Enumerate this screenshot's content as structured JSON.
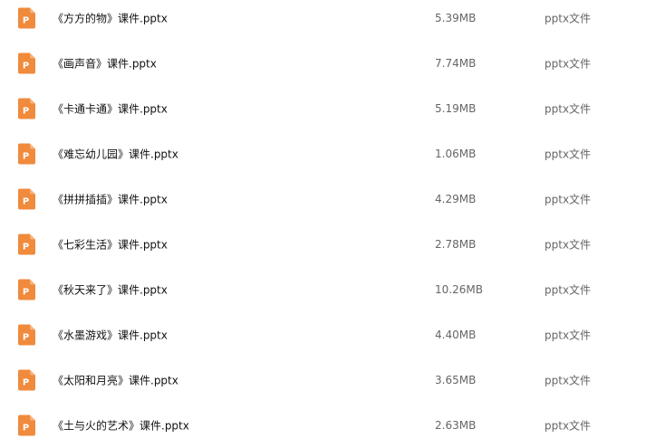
{
  "colors": {
    "icon_orange": "#f08a3c",
    "icon_orange_light": "#f7b27a",
    "icon_letter": "#ffffff",
    "text_primary": "#111111",
    "text_secondary": "#666666"
  },
  "files": [
    {
      "icon": "pptx-file-icon",
      "name": "《方方的物》课件.pptx",
      "size": "5.39MB",
      "type": "pptx文件"
    },
    {
      "icon": "pptx-file-icon",
      "name": "《画声音》课件.pptx",
      "size": "7.74MB",
      "type": "pptx文件"
    },
    {
      "icon": "pptx-file-icon",
      "name": "《卡通卡通》课件.pptx",
      "size": "5.19MB",
      "type": "pptx文件"
    },
    {
      "icon": "pptx-file-icon",
      "name": "《难忘幼儿园》课件.pptx",
      "size": "1.06MB",
      "type": "pptx文件"
    },
    {
      "icon": "pptx-file-icon",
      "name": "《拼拼插插》课件.pptx",
      "size": "4.29MB",
      "type": "pptx文件"
    },
    {
      "icon": "pptx-file-icon",
      "name": "《七彩生活》课件.pptx",
      "size": "2.78MB",
      "type": "pptx文件"
    },
    {
      "icon": "pptx-file-icon",
      "name": "《秋天来了》课件.pptx",
      "size": "10.26MB",
      "type": "pptx文件"
    },
    {
      "icon": "pptx-file-icon",
      "name": "《水墨游戏》课件.pptx",
      "size": "4.40MB",
      "type": "pptx文件"
    },
    {
      "icon": "pptx-file-icon",
      "name": "《太阳和月亮》课件.pptx",
      "size": "3.65MB",
      "type": "pptx文件"
    },
    {
      "icon": "pptx-file-icon",
      "name": "《土与火的艺术》课件.pptx",
      "size": "2.63MB",
      "type": "pptx文件"
    }
  ]
}
